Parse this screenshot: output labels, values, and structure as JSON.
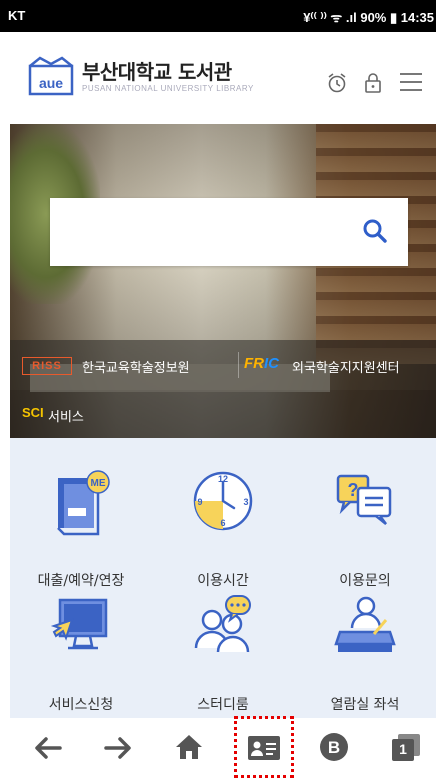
{
  "status_bar": {
    "carrier": "KT",
    "indicators": "¥⁽⁽ ⁾⁾ ᯤ .ıl 90% ▮ 14:35"
  },
  "header": {
    "title": "부산대학교 도서관",
    "subtitle": "PUSAN NATIONAL UNIVERSITY LIBRARY",
    "icons": [
      "logo-icon",
      "alarm-clock-icon",
      "lock-icon",
      "hamburger-menu-icon"
    ]
  },
  "search": {
    "placeholder": "",
    "icon": "search-icon"
  },
  "links": {
    "riss_logo": "RISS",
    "riss_label": "한국교육학술정보원",
    "fric_logo_a": "FR",
    "fric_logo_b": "IC",
    "fric_label": "외국학술지지원센터",
    "sci_logo": "SCI",
    "sci_label": "서비스"
  },
  "menu": [
    {
      "label": "대출/예약/연장",
      "icon": "book-me-icon"
    },
    {
      "label": "이용시간",
      "icon": "clock-icon"
    },
    {
      "label": "이용문의",
      "icon": "question-chat-icon"
    },
    {
      "label": "서비스신청",
      "icon": "monitor-pointer-icon"
    },
    {
      "label": "스터디룸",
      "icon": "study-group-icon"
    },
    {
      "label": "열람실 좌석",
      "icon": "reading-desk-icon"
    }
  ],
  "bottom_nav": {
    "items": [
      "back-arrow-icon",
      "forward-arrow-icon",
      "home-icon",
      "id-card-icon",
      "b-circle-icon",
      "tabs-icon"
    ],
    "tab_count": "1"
  },
  "colors": {
    "accent_blue": "#3b63c4",
    "menu_bg": "#e9eff8",
    "icon_yellow": "#f7d35a",
    "highlight": "#e50000"
  }
}
